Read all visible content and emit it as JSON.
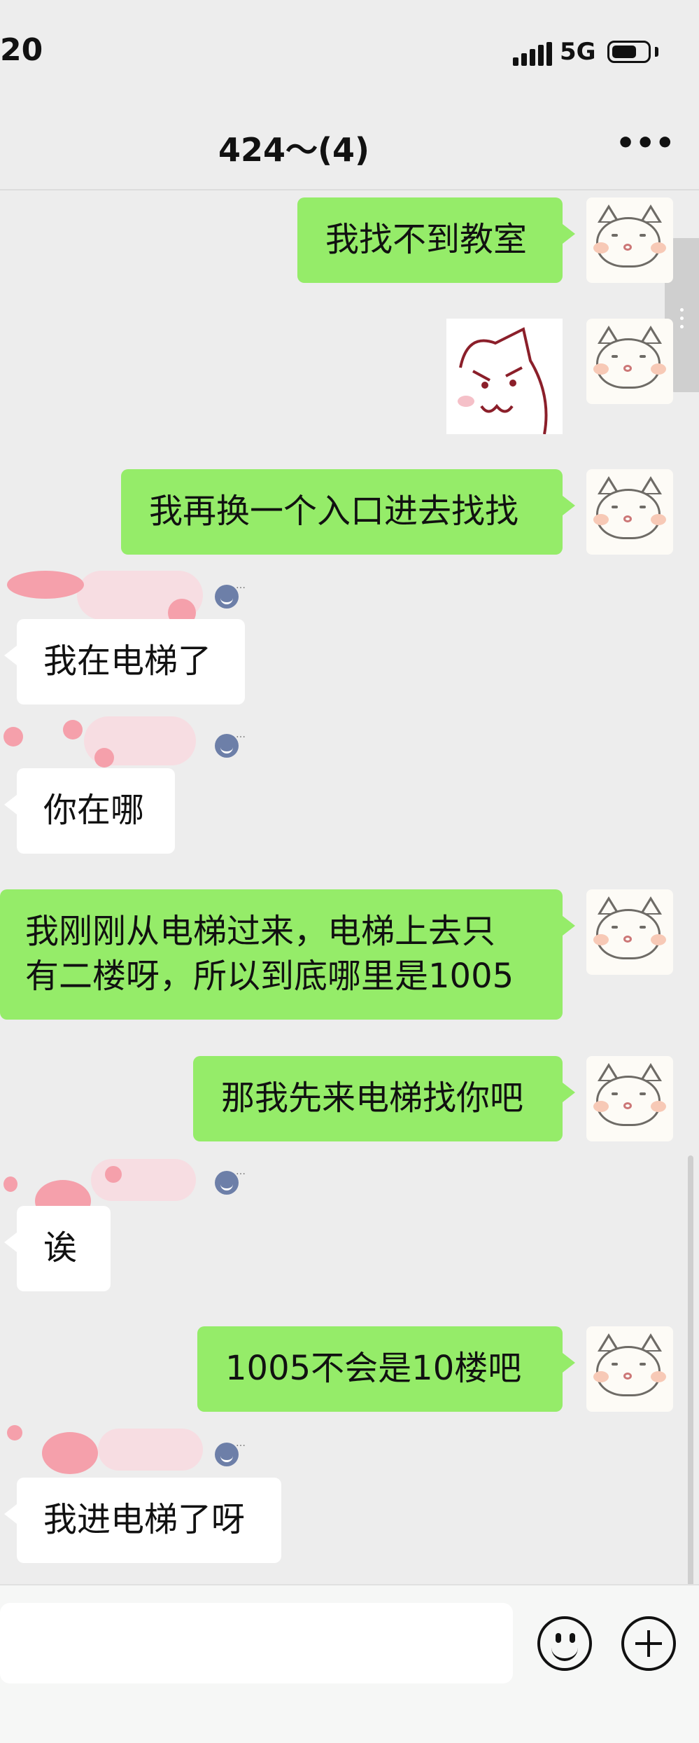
{
  "status_bar": {
    "time": "20",
    "network": "5G"
  },
  "header": {
    "title": "424～(4)",
    "more_label": "•••"
  },
  "messages": [
    {
      "direction": "out",
      "text": "我找不到教室"
    },
    {
      "direction": "out",
      "type": "sticker"
    },
    {
      "direction": "out",
      "text": "我再换一个入口进去找找"
    },
    {
      "direction": "in",
      "text": "我在电梯了"
    },
    {
      "direction": "in",
      "text": "你在哪"
    },
    {
      "direction": "out",
      "lines": [
        "我刚刚从电梯过来，电梯上去只",
        "有二楼呀，所以到底哪里是1005"
      ]
    },
    {
      "direction": "out",
      "text": "那我先来电梯找你吧"
    },
    {
      "direction": "in",
      "text": "诶"
    },
    {
      "direction": "out",
      "text": "1005不会是10楼吧"
    },
    {
      "direction": "in",
      "text": "我进电梯了呀"
    }
  ],
  "badge_dots": "…",
  "colors": {
    "background": "#ededed",
    "outgoing_bubble": "#95ec69",
    "incoming_bubble": "#ffffff"
  },
  "icons": {
    "emoji": "emoji-icon",
    "plus": "plus-icon",
    "more": "more-icon"
  }
}
